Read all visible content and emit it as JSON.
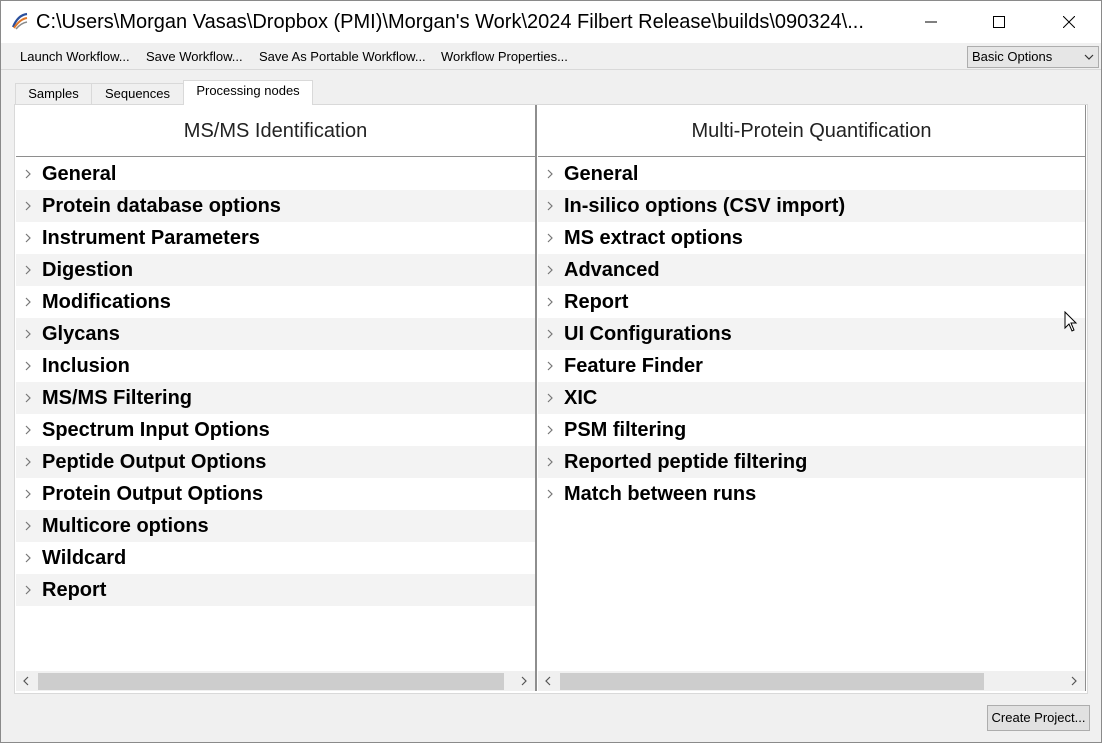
{
  "window": {
    "title": "C:\\Users\\Morgan Vasas\\Dropbox (PMI)\\Morgan's Work\\2024 Filbert Release\\builds\\090324\\..."
  },
  "toolbar": {
    "items": [
      "Launch Workflow...",
      "Save Workflow...",
      "Save As Portable Workflow...",
      "Workflow Properties..."
    ],
    "mode_select": "Basic Options"
  },
  "tabs": [
    "Samples",
    "Sequences",
    "Processing nodes"
  ],
  "active_tab": "Processing nodes",
  "left_panel": {
    "header": "MS/MS Identification",
    "items": [
      "General",
      "Protein database options",
      "Instrument Parameters",
      "Digestion",
      "Modifications",
      "Glycans",
      "Inclusion",
      "MS/MS Filtering",
      "Spectrum Input Options",
      "Peptide Output Options",
      "Protein Output Options",
      "Multicore options",
      "Wildcard",
      "Report"
    ]
  },
  "right_panel": {
    "header": "Multi-Protein Quantification",
    "items": [
      "General",
      "In-silico options (CSV import)",
      "MS extract options",
      "Advanced",
      "Report",
      "UI Configurations",
      "Feature Finder",
      "XIC",
      "PSM filtering",
      "Reported peptide filtering",
      "Match between runs"
    ]
  },
  "footer": {
    "create_button": "Create Project..."
  }
}
